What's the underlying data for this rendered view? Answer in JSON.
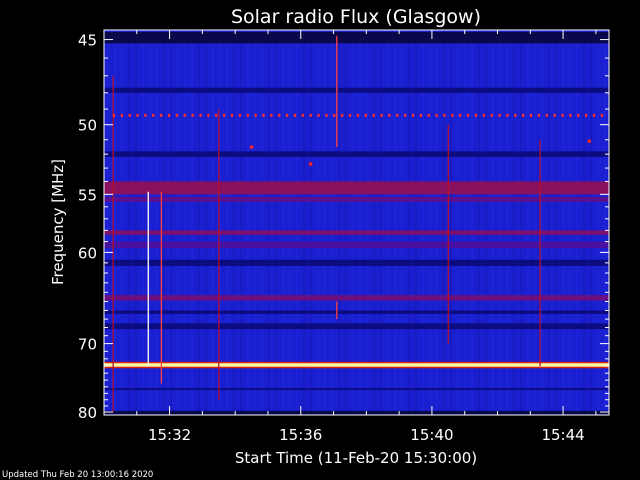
{
  "chart_data": {
    "type": "heatmap",
    "title": "Solar radio Flux (Glasgow)",
    "xlabel": "Start Time (11-Feb-20 15:30:00)",
    "ylabel": "Frequency [MHz]",
    "footer": "Updated Thu Feb 20 13:00:16 2020",
    "x_range_minutes": [
      0,
      15.4
    ],
    "x_ticks": [
      {
        "minute": 2,
        "label": "15:32"
      },
      {
        "minute": 6,
        "label": "15:36"
      },
      {
        "minute": 10,
        "label": "15:40"
      },
      {
        "minute": 14,
        "label": "15:44"
      }
    ],
    "y_range_mhz": [
      44.5,
      80.5
    ],
    "y_scale": "reciprocal",
    "y_ticks": [
      {
        "mhz": 45,
        "label": "45"
      },
      {
        "mhz": 50,
        "label": "50"
      },
      {
        "mhz": 55,
        "label": "55"
      },
      {
        "mhz": 60,
        "label": "60"
      },
      {
        "mhz": 70,
        "label": "70"
      },
      {
        "mhz": 80,
        "label": "80"
      }
    ],
    "background_color": "#1a1fd0",
    "bands": [
      {
        "mhz_from": 44.6,
        "mhz_to": 45.2,
        "color": "#08084a"
      },
      {
        "mhz_from": 47.7,
        "mhz_to": 48.0,
        "color": "#0c0c80"
      },
      {
        "mhz_from": 51.8,
        "mhz_to": 52.2,
        "color": "#0c0c80"
      },
      {
        "mhz_from": 54.0,
        "mhz_to": 55.0,
        "color": "#8a1060"
      },
      {
        "mhz_from": 55.2,
        "mhz_to": 55.6,
        "color": "#5a1090"
      },
      {
        "mhz_from": 58.0,
        "mhz_to": 58.4,
        "color": "#7a1070"
      },
      {
        "mhz_from": 59.0,
        "mhz_to": 59.6,
        "color": "#4a10a0"
      },
      {
        "mhz_from": 60.7,
        "mhz_to": 61.3,
        "color": "#0c0c80"
      },
      {
        "mhz_from": 64.3,
        "mhz_to": 64.9,
        "color": "#6a1080"
      },
      {
        "mhz_from": 66.0,
        "mhz_to": 66.4,
        "color": "#0c0c80"
      },
      {
        "mhz_from": 67.5,
        "mhz_to": 68.2,
        "color": "#0c0c80"
      },
      {
        "mhz_from": 72.4,
        "mhz_to": 72.6,
        "color": "#e02000"
      },
      {
        "mhz_from": 72.6,
        "mhz_to": 73.1,
        "color": "#ffffa0"
      },
      {
        "mhz_from": 73.1,
        "mhz_to": 73.3,
        "color": "#e02000"
      },
      {
        "mhz_from": 76.2,
        "mhz_to": 76.5,
        "color": "#0c0c80"
      },
      {
        "mhz_from": 79.8,
        "mhz_to": 80.5,
        "color": "#08084a"
      }
    ],
    "dotted_line": {
      "mhz": 49.4,
      "minute_start": 0.3,
      "minute_step": 0.24,
      "color": "#ff3020"
    },
    "vertical_streaks": [
      {
        "minute": 0.28,
        "mhz_from": 47,
        "mhz_to": 80,
        "color": "#b01030"
      },
      {
        "minute": 1.35,
        "mhz_from": 54.8,
        "mhz_to": 73,
        "color": "#ffffff"
      },
      {
        "minute": 1.75,
        "mhz_from": 54.8,
        "mhz_to": 75.5,
        "color": "#ff4040"
      },
      {
        "minute": 3.5,
        "mhz_from": 49,
        "mhz_to": 78,
        "color": "#b01030"
      },
      {
        "minute": 7.1,
        "mhz_from": 44.8,
        "mhz_to": 51.5,
        "color": "#ff4040"
      },
      {
        "minute": 7.1,
        "mhz_from": 65,
        "mhz_to": 67,
        "color": "#ff4040"
      },
      {
        "minute": 10.5,
        "mhz_from": 50,
        "mhz_to": 70,
        "color": "#b01030"
      },
      {
        "minute": 13.3,
        "mhz_from": 51,
        "mhz_to": 73,
        "color": "#b01030"
      }
    ],
    "hotspots": [
      {
        "minute": 4.5,
        "mhz": 51.5,
        "color": "#ff2020"
      },
      {
        "minute": 6.3,
        "mhz": 52.7,
        "color": "#ff2020"
      },
      {
        "minute": 14.8,
        "mhz": 51.1,
        "color": "#ff2020"
      }
    ]
  }
}
